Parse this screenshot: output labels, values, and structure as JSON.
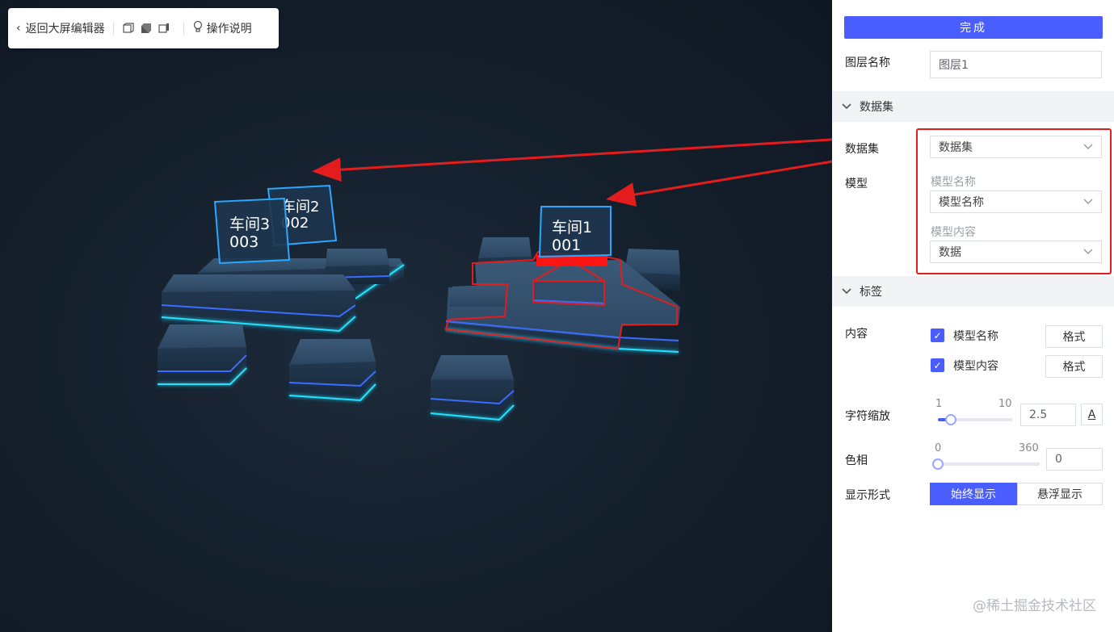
{
  "toolbar": {
    "back_label": "返回大屏编辑器",
    "view_icons": [
      "front-view-icon",
      "perspective-view-icon",
      "side-view-icon"
    ],
    "help_label": "操作说明"
  },
  "scene": {
    "labels": [
      {
        "name": "车间1",
        "code": "001"
      },
      {
        "name": "车间2",
        "code": "002"
      },
      {
        "name": "车间3",
        "code": "003"
      }
    ]
  },
  "panel": {
    "done_label": "完成",
    "layer_name_label": "图层名称",
    "layer_name_value": "图层1",
    "dataset_section": "数据集",
    "dataset_label": "数据集",
    "dataset_select": "数据集",
    "model_label": "模型",
    "model_name_sub": "模型名称",
    "model_name_select": "模型名称",
    "model_content_sub": "模型内容",
    "model_content_select": "数据",
    "tag_section": "标签",
    "content_label": "内容",
    "check_model_name": "模型名称",
    "check_model_content": "模型内容",
    "format_label": "格式",
    "char_scale_label": "字符缩放",
    "char_scale_min": "1",
    "char_scale_max": "10",
    "char_scale_value": "2.5",
    "font_btn": "A",
    "hue_label": "色相",
    "hue_min": "0",
    "hue_max": "360",
    "hue_value": "0",
    "display_label": "显示形式",
    "display_always": "始终显示",
    "display_hover": "悬浮显示"
  },
  "watermark": "@稀土掘金技术社区",
  "colors": {
    "accent": "#4a5eff",
    "highlight": "#e31d1d",
    "scene_bg": "#15202d",
    "glow": "#21e3ff"
  }
}
